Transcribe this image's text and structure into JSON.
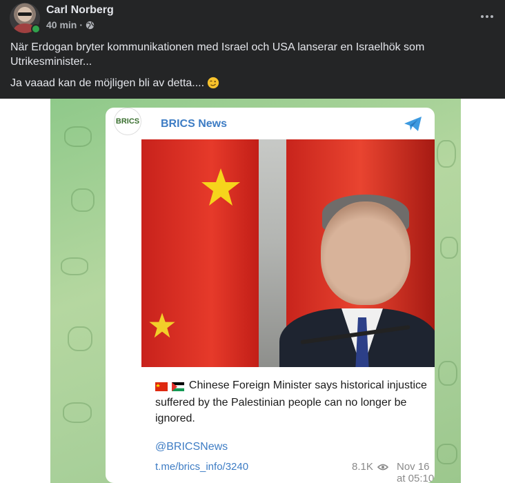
{
  "post": {
    "author": "Carl Norberg",
    "time": "40 min",
    "separator": "·",
    "text_line1": "När Erdogan bryter kommunikationen med Israel och USA lanserar en Israelhök som Utrikesminister...",
    "text_line2": "Ja vaaad kan de möjligen bli av detta....",
    "emoji": "wink-emoji"
  },
  "card": {
    "logo_text": "BRICS",
    "channel_name": "BRICS News",
    "caption": "Chinese Foreign Minister says historical injustice suffered by the Palestinian people can no longer be ignored.",
    "handle": "@BRICSNews",
    "link": "t.me/brics_info/3240",
    "views": "8.1K",
    "date": "Nov 16 at 05:10"
  },
  "icons": [
    "more-options-icon",
    "globe-icon",
    "wink-emoji-icon",
    "telegram-icon",
    "eye-icon",
    "china-flag-icon",
    "palestine-flag-icon"
  ],
  "colors": {
    "background": "#242526",
    "text": "#e4e6eb",
    "muted": "#b0b3b8",
    "online": "#31a24c",
    "link_blue": "#3d7cc4",
    "telegram_green": "#a9d09a"
  }
}
